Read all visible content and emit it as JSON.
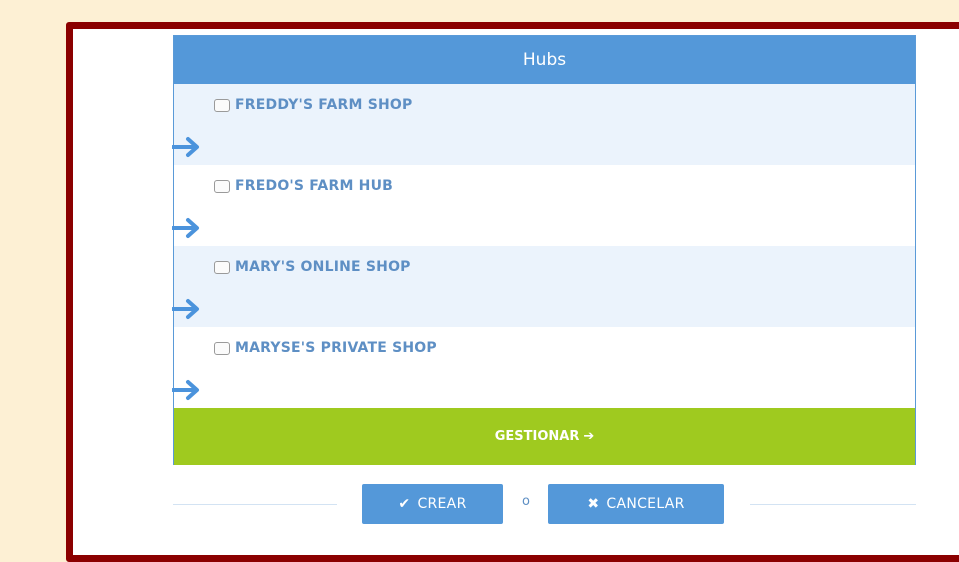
{
  "panel": {
    "title": "Hubs"
  },
  "hubs": [
    {
      "name": "FREDDY'S FARM SHOP",
      "checked": false
    },
    {
      "name": "FREDO'S FARM HUB",
      "checked": false
    },
    {
      "name": "MARY'S ONLINE SHOP",
      "checked": false
    },
    {
      "name": "MARYSE'S PRIVATE SHOP",
      "checked": false
    }
  ],
  "actions": {
    "manage_label": "GESTIONAR",
    "create_label": "CREAR",
    "or_label": "o",
    "cancel_label": "CANCELAR"
  },
  "icons": {
    "row_arrow": "arrow-right-icon",
    "manage_arrow": "arrow-right-icon",
    "create": "check-icon",
    "cancel": "close-icon"
  },
  "colors": {
    "header": "#5498d9",
    "alt_row": "#ebf3fc",
    "manage_bar": "#9fca1f",
    "frame_border": "#8b0000",
    "page_bg": "#fdf0d4",
    "hub_text": "#5e8fc4"
  }
}
